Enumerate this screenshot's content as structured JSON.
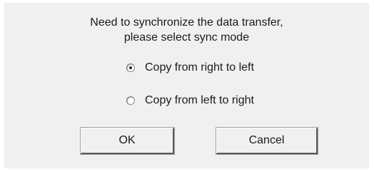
{
  "dialog": {
    "message_line1": "Need to synchronize the data transfer,",
    "message_line2": "please select sync mode",
    "options": [
      {
        "label": "Copy from right to left",
        "selected": true
      },
      {
        "label": "Copy from left to right",
        "selected": false
      }
    ],
    "buttons": {
      "ok_label": "OK",
      "cancel_label": "Cancel"
    }
  }
}
